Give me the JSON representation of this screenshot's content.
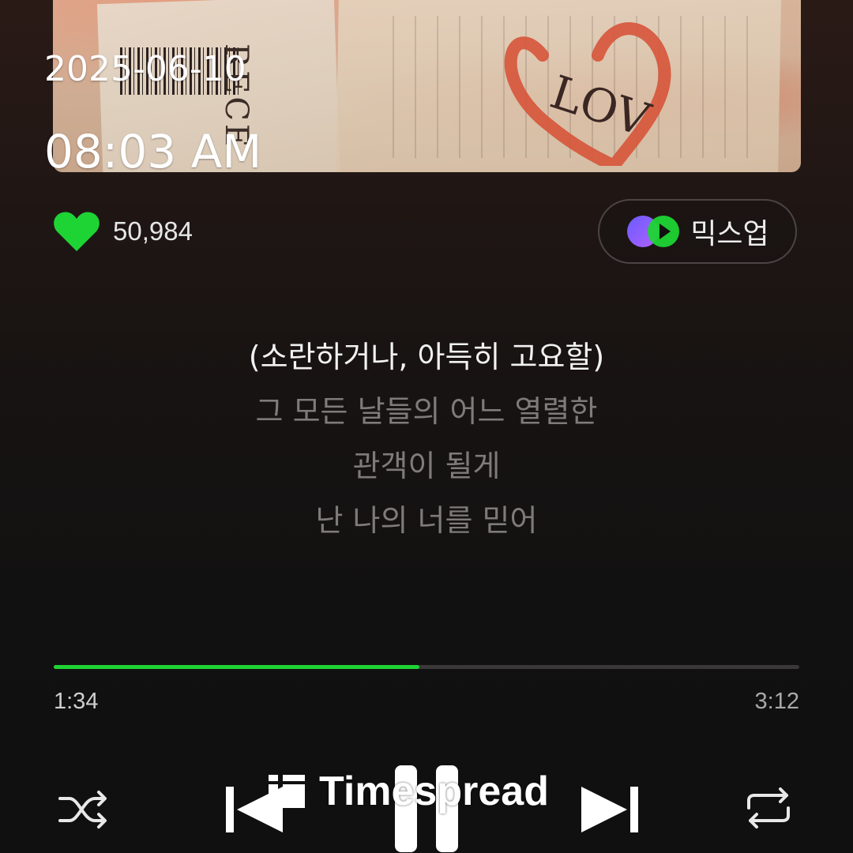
{
  "overlay": {
    "date": "2025-06-10",
    "time": "08:03 AM"
  },
  "album_art": {
    "receipt_text": "RECE",
    "scribble_text": "LOV",
    "accent_color": "#d6543a"
  },
  "like": {
    "count": "50,984",
    "icon": "heart-icon",
    "color": "#1ed434"
  },
  "mixup": {
    "label": "믹스업",
    "icon": "mixup-icon"
  },
  "lyrics": [
    {
      "text": "(소란하거나, 아득히 고요할)",
      "current": true
    },
    {
      "text": "그 모든 날들의 어느 열렬한",
      "current": false
    },
    {
      "text": "관객이 될게",
      "current": false
    },
    {
      "text": "난 나의 너를 믿어",
      "current": false
    }
  ],
  "progress": {
    "elapsed": "1:34",
    "total": "3:12",
    "fraction": 0.49,
    "color": "#1ed434"
  },
  "controls": {
    "shuffle": "shuffle-icon",
    "previous": "skip-previous-icon",
    "pause": "pause-icon",
    "next": "skip-next-icon",
    "repeat": "repeat-icon"
  },
  "watermark": {
    "text": "Timespread"
  }
}
